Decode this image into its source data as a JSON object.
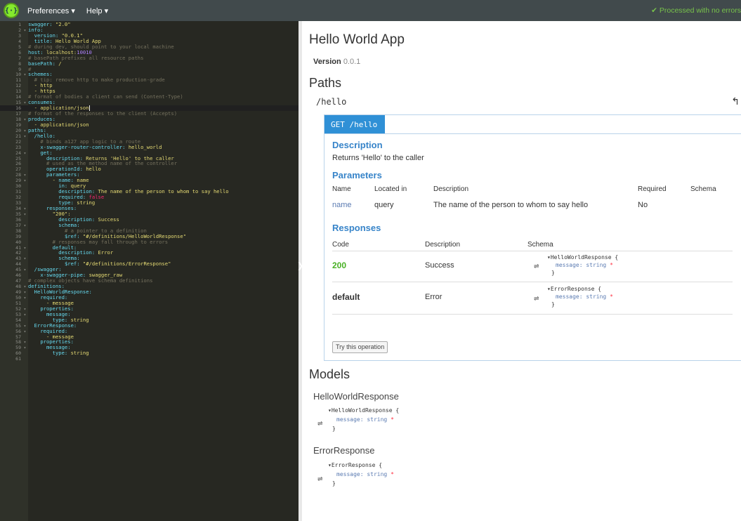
{
  "topbar": {
    "logo_text": "{·}",
    "menu": [
      "Preferences ▾",
      "Help ▾"
    ],
    "status": "✔ Processed with no errors"
  },
  "editor": {
    "lines": [
      {
        "n": "1",
        "f": "",
        "t": [
          [
            "k",
            "swagger: "
          ],
          [
            "s",
            "\"2.0\""
          ]
        ]
      },
      {
        "n": "2",
        "f": "▾",
        "t": [
          [
            "k",
            "info:"
          ]
        ]
      },
      {
        "n": "3",
        "f": "",
        "t": [
          [
            "p",
            "  "
          ],
          [
            "k",
            "version: "
          ],
          [
            "s",
            "\"0.0.1\""
          ]
        ]
      },
      {
        "n": "4",
        "f": "",
        "t": [
          [
            "p",
            "  "
          ],
          [
            "k",
            "title: "
          ],
          [
            "s",
            "Hello World App"
          ]
        ]
      },
      {
        "n": "5",
        "f": "",
        "t": [
          [
            "c",
            "# during dev, should point to your local machine"
          ]
        ]
      },
      {
        "n": "6",
        "f": "",
        "t": [
          [
            "k",
            "host: "
          ],
          [
            "s",
            "localhost:"
          ],
          [
            "n",
            "10010"
          ]
        ]
      },
      {
        "n": "7",
        "f": "",
        "t": [
          [
            "c",
            "# basePath prefixes all resource paths"
          ]
        ]
      },
      {
        "n": "8",
        "f": "",
        "t": [
          [
            "k",
            "basePath: "
          ],
          [
            "s",
            "/"
          ]
        ]
      },
      {
        "n": "9",
        "f": "",
        "t": [
          [
            "c",
            "#"
          ]
        ]
      },
      {
        "n": "10",
        "f": "▾",
        "t": [
          [
            "k",
            "schemes:"
          ]
        ]
      },
      {
        "n": "11",
        "f": "",
        "t": [
          [
            "p",
            "  "
          ],
          [
            "c",
            "# tip: remove http to make production-grade"
          ]
        ]
      },
      {
        "n": "12",
        "f": "",
        "t": [
          [
            "p",
            "  "
          ],
          [
            "s",
            "- http"
          ]
        ]
      },
      {
        "n": "13",
        "f": "",
        "t": [
          [
            "p",
            "  "
          ],
          [
            "s",
            "- https"
          ]
        ]
      },
      {
        "n": "14",
        "f": "",
        "t": [
          [
            "c",
            "# format of bodies a client can send (Content-Type)"
          ]
        ]
      },
      {
        "n": "15",
        "f": "▾",
        "t": [
          [
            "k",
            "consumes:"
          ]
        ]
      },
      {
        "n": "16",
        "f": "",
        "t": [
          [
            "p",
            "  "
          ],
          [
            "s",
            "- application/json"
          ]
        ],
        "active": true
      },
      {
        "n": "17",
        "f": "",
        "t": [
          [
            "c",
            "# format of the responses to the client (Accepts)"
          ]
        ]
      },
      {
        "n": "18",
        "f": "▾",
        "t": [
          [
            "k",
            "produces:"
          ]
        ]
      },
      {
        "n": "19",
        "f": "",
        "t": [
          [
            "p",
            "  "
          ],
          [
            "s",
            "- application/json"
          ]
        ]
      },
      {
        "n": "20",
        "f": "▾",
        "t": [
          [
            "k",
            "paths:"
          ]
        ]
      },
      {
        "n": "21",
        "f": "▾",
        "t": [
          [
            "p",
            "  "
          ],
          [
            "k",
            "/hello:"
          ]
        ]
      },
      {
        "n": "22",
        "f": "",
        "t": [
          [
            "p",
            "    "
          ],
          [
            "c",
            "# binds a127 app logic to a route"
          ]
        ]
      },
      {
        "n": "23",
        "f": "",
        "t": [
          [
            "p",
            "    "
          ],
          [
            "k",
            "x-swagger-router-controller: "
          ],
          [
            "s",
            "hello_world"
          ]
        ]
      },
      {
        "n": "24",
        "f": "▾",
        "t": [
          [
            "p",
            "    "
          ],
          [
            "k",
            "get:"
          ]
        ]
      },
      {
        "n": "25",
        "f": "",
        "t": [
          [
            "p",
            "      "
          ],
          [
            "k",
            "description: "
          ],
          [
            "s",
            "Returns 'Hello' to the caller"
          ]
        ]
      },
      {
        "n": "26",
        "f": "",
        "t": [
          [
            "p",
            "      "
          ],
          [
            "c",
            "# used as the method name of the controller"
          ]
        ]
      },
      {
        "n": "27",
        "f": "",
        "t": [
          [
            "p",
            "      "
          ],
          [
            "k",
            "operationId: "
          ],
          [
            "s",
            "hello"
          ]
        ]
      },
      {
        "n": "28",
        "f": "▾",
        "t": [
          [
            "p",
            "      "
          ],
          [
            "k",
            "parameters:"
          ]
        ]
      },
      {
        "n": "29",
        "f": "▾",
        "t": [
          [
            "p",
            "        "
          ],
          [
            "s",
            "- "
          ],
          [
            "k",
            "name: "
          ],
          [
            "s",
            "name"
          ]
        ]
      },
      {
        "n": "30",
        "f": "",
        "t": [
          [
            "p",
            "          "
          ],
          [
            "k",
            "in: "
          ],
          [
            "s",
            "query"
          ]
        ]
      },
      {
        "n": "31",
        "f": "",
        "t": [
          [
            "p",
            "          "
          ],
          [
            "k",
            "description: "
          ],
          [
            "s",
            "The name of the person to whom to say hello"
          ]
        ]
      },
      {
        "n": "32",
        "f": "",
        "t": [
          [
            "p",
            "          "
          ],
          [
            "k",
            "required: "
          ],
          [
            "r",
            "false"
          ]
        ]
      },
      {
        "n": "33",
        "f": "",
        "t": [
          [
            "p",
            "          "
          ],
          [
            "k",
            "type: "
          ],
          [
            "s",
            "string"
          ]
        ]
      },
      {
        "n": "34",
        "f": "▾",
        "t": [
          [
            "p",
            "      "
          ],
          [
            "k",
            "responses:"
          ]
        ]
      },
      {
        "n": "35",
        "f": "▾",
        "t": [
          [
            "p",
            "        "
          ],
          [
            "s",
            "\"200\":"
          ]
        ]
      },
      {
        "n": "36",
        "f": "",
        "t": [
          [
            "p",
            "          "
          ],
          [
            "k",
            "description: "
          ],
          [
            "s",
            "Success"
          ]
        ]
      },
      {
        "n": "37",
        "f": "▾",
        "t": [
          [
            "p",
            "          "
          ],
          [
            "k",
            "schema:"
          ]
        ]
      },
      {
        "n": "38",
        "f": "",
        "t": [
          [
            "p",
            "            "
          ],
          [
            "c",
            "# a pointer to a definition"
          ]
        ]
      },
      {
        "n": "39",
        "f": "",
        "t": [
          [
            "p",
            "            "
          ],
          [
            "k",
            "$ref: "
          ],
          [
            "s",
            "\"#/definitions/HelloWorldResponse\""
          ]
        ]
      },
      {
        "n": "40",
        "f": "",
        "t": [
          [
            "p",
            "        "
          ],
          [
            "c",
            "# responses may fall through to errors"
          ]
        ]
      },
      {
        "n": "41",
        "f": "▾",
        "t": [
          [
            "p",
            "        "
          ],
          [
            "k",
            "default:"
          ]
        ]
      },
      {
        "n": "42",
        "f": "",
        "t": [
          [
            "p",
            "          "
          ],
          [
            "k",
            "description: "
          ],
          [
            "s",
            "Error"
          ]
        ]
      },
      {
        "n": "43",
        "f": "▾",
        "t": [
          [
            "p",
            "          "
          ],
          [
            "k",
            "schema:"
          ]
        ]
      },
      {
        "n": "44",
        "f": "",
        "t": [
          [
            "p",
            "            "
          ],
          [
            "k",
            "$ref: "
          ],
          [
            "s",
            "\"#/definitions/ErrorResponse\""
          ]
        ]
      },
      {
        "n": "45",
        "f": "▾",
        "t": [
          [
            "p",
            "  "
          ],
          [
            "k",
            "/swagger:"
          ]
        ]
      },
      {
        "n": "46",
        "f": "",
        "t": [
          [
            "p",
            "    "
          ],
          [
            "k",
            "x-swagger-pipe: "
          ],
          [
            "s",
            "swagger_raw"
          ]
        ]
      },
      {
        "n": "47",
        "f": "",
        "t": [
          [
            "c",
            "# complex objects have schema definitions"
          ]
        ]
      },
      {
        "n": "48",
        "f": "▾",
        "t": [
          [
            "k",
            "definitions:"
          ]
        ]
      },
      {
        "n": "49",
        "f": "▾",
        "t": [
          [
            "p",
            "  "
          ],
          [
            "k",
            "HelloWorldResponse:"
          ]
        ]
      },
      {
        "n": "50",
        "f": "▾",
        "t": [
          [
            "p",
            "    "
          ],
          [
            "k",
            "required:"
          ]
        ]
      },
      {
        "n": "51",
        "f": "",
        "t": [
          [
            "p",
            "      "
          ],
          [
            "s",
            "- message"
          ]
        ]
      },
      {
        "n": "52",
        "f": "▾",
        "t": [
          [
            "p",
            "    "
          ],
          [
            "k",
            "properties:"
          ]
        ]
      },
      {
        "n": "53",
        "f": "▾",
        "t": [
          [
            "p",
            "      "
          ],
          [
            "k",
            "message:"
          ]
        ]
      },
      {
        "n": "54",
        "f": "",
        "t": [
          [
            "p",
            "        "
          ],
          [
            "k",
            "type: "
          ],
          [
            "s",
            "string"
          ]
        ]
      },
      {
        "n": "55",
        "f": "▾",
        "t": [
          [
            "p",
            "  "
          ],
          [
            "k",
            "ErrorResponse:"
          ]
        ]
      },
      {
        "n": "56",
        "f": "▾",
        "t": [
          [
            "p",
            "    "
          ],
          [
            "k",
            "required:"
          ]
        ]
      },
      {
        "n": "57",
        "f": "",
        "t": [
          [
            "p",
            "      "
          ],
          [
            "s",
            "- message"
          ]
        ]
      },
      {
        "n": "58",
        "f": "▾",
        "t": [
          [
            "p",
            "    "
          ],
          [
            "k",
            "properties:"
          ]
        ]
      },
      {
        "n": "59",
        "f": "▾",
        "t": [
          [
            "p",
            "      "
          ],
          [
            "k",
            "message:"
          ]
        ]
      },
      {
        "n": "60",
        "f": "",
        "t": [
          [
            "p",
            "        "
          ],
          [
            "k",
            "type: "
          ],
          [
            "s",
            "string"
          ]
        ]
      },
      {
        "n": "61",
        "f": "",
        "t": []
      }
    ]
  },
  "preview": {
    "title": "Hello World App",
    "version_label": "Version",
    "version_value": "0.0.1",
    "paths_heading": "Paths",
    "path_name": "/hello",
    "operation": {
      "method_path": "GET /hello",
      "description_heading": "Description",
      "description": "Returns 'Hello' to the caller",
      "parameters_heading": "Parameters",
      "param_headers": [
        "Name",
        "Located in",
        "Description",
        "Required",
        "Schema"
      ],
      "param_row": {
        "name": "name",
        "in": "query",
        "description": "The name of the person to whom to say hello",
        "required": "No"
      },
      "responses_heading": "Responses",
      "resp_headers": [
        "Code",
        "Description",
        "Schema"
      ],
      "responses": [
        {
          "code": "200",
          "description": "Success",
          "schema_title": "▾HelloWorldResponse {",
          "prop": "message",
          "type": ": string",
          "req": "*",
          "close": "}"
        },
        {
          "code": "default",
          "description": "Error",
          "schema_title": "▾ErrorResponse {",
          "prop": "message",
          "type": ": string",
          "req": "*",
          "close": "}"
        }
      ],
      "try_button": "Try this operation"
    },
    "models_heading": "Models",
    "models": [
      {
        "name": "HelloWorldResponse",
        "schema_title": "▾HelloWorldResponse {",
        "prop": "message",
        "type": ": string",
        "req": "*",
        "close": "}"
      },
      {
        "name": "ErrorResponse",
        "schema_title": "▾ErrorResponse {",
        "prop": "message",
        "type": ": string",
        "req": "*",
        "close": "}"
      }
    ]
  },
  "colors": {
    "topbar": "#414a4c",
    "editor_bg": "#272822",
    "method_blue": "#2f90d6",
    "heading_blue": "#3784c9",
    "success_green": "#49b125"
  }
}
